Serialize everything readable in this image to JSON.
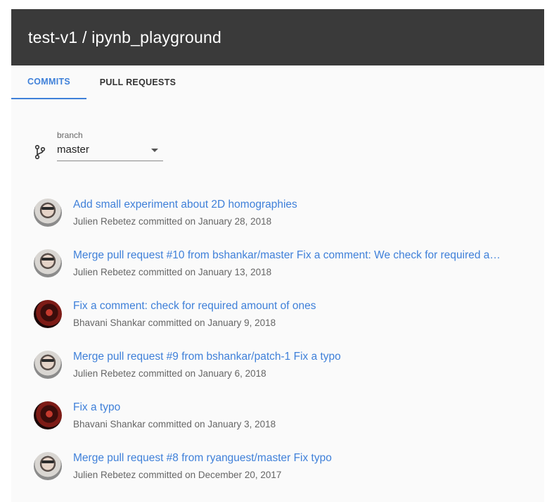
{
  "header": {
    "title": "test-v1 / ipynb_playground"
  },
  "tabs": [
    {
      "label": "COMMITS",
      "active": true
    },
    {
      "label": "PULL REQUESTS",
      "active": false
    }
  ],
  "branch": {
    "label": "branch",
    "value": "master",
    "icon": "git-branch-icon"
  },
  "commits": [
    {
      "title": "Add small experiment about 2D homographies",
      "author": "Julien Rebetez",
      "meta": "Julien Rebetez committed on January 28, 2018"
    },
    {
      "title": "Merge pull request #10 from bshankar/master Fix a comment: We check for required a…",
      "author": "Julien Rebetez",
      "meta": "Julien Rebetez committed on January 13, 2018"
    },
    {
      "title": "Fix a comment: check for required amount of ones",
      "author": "Bhavani Shankar",
      "meta": "Bhavani Shankar committed on January 9, 2018"
    },
    {
      "title": "Merge pull request #9 from bshankar/patch-1 Fix a typo",
      "author": "Julien Rebetez",
      "meta": "Julien Rebetez committed on January 6, 2018"
    },
    {
      "title": "Fix a typo",
      "author": "Bhavani Shankar",
      "meta": "Bhavani Shankar committed on January 3, 2018"
    },
    {
      "title": "Merge pull request #8 from ryanguest/master Fix typo",
      "author": "Julien Rebetez",
      "meta": "Julien Rebetez committed on December 20, 2017"
    }
  ],
  "colors": {
    "accent": "#3f80d9",
    "header_bg": "#3a3a3a"
  }
}
